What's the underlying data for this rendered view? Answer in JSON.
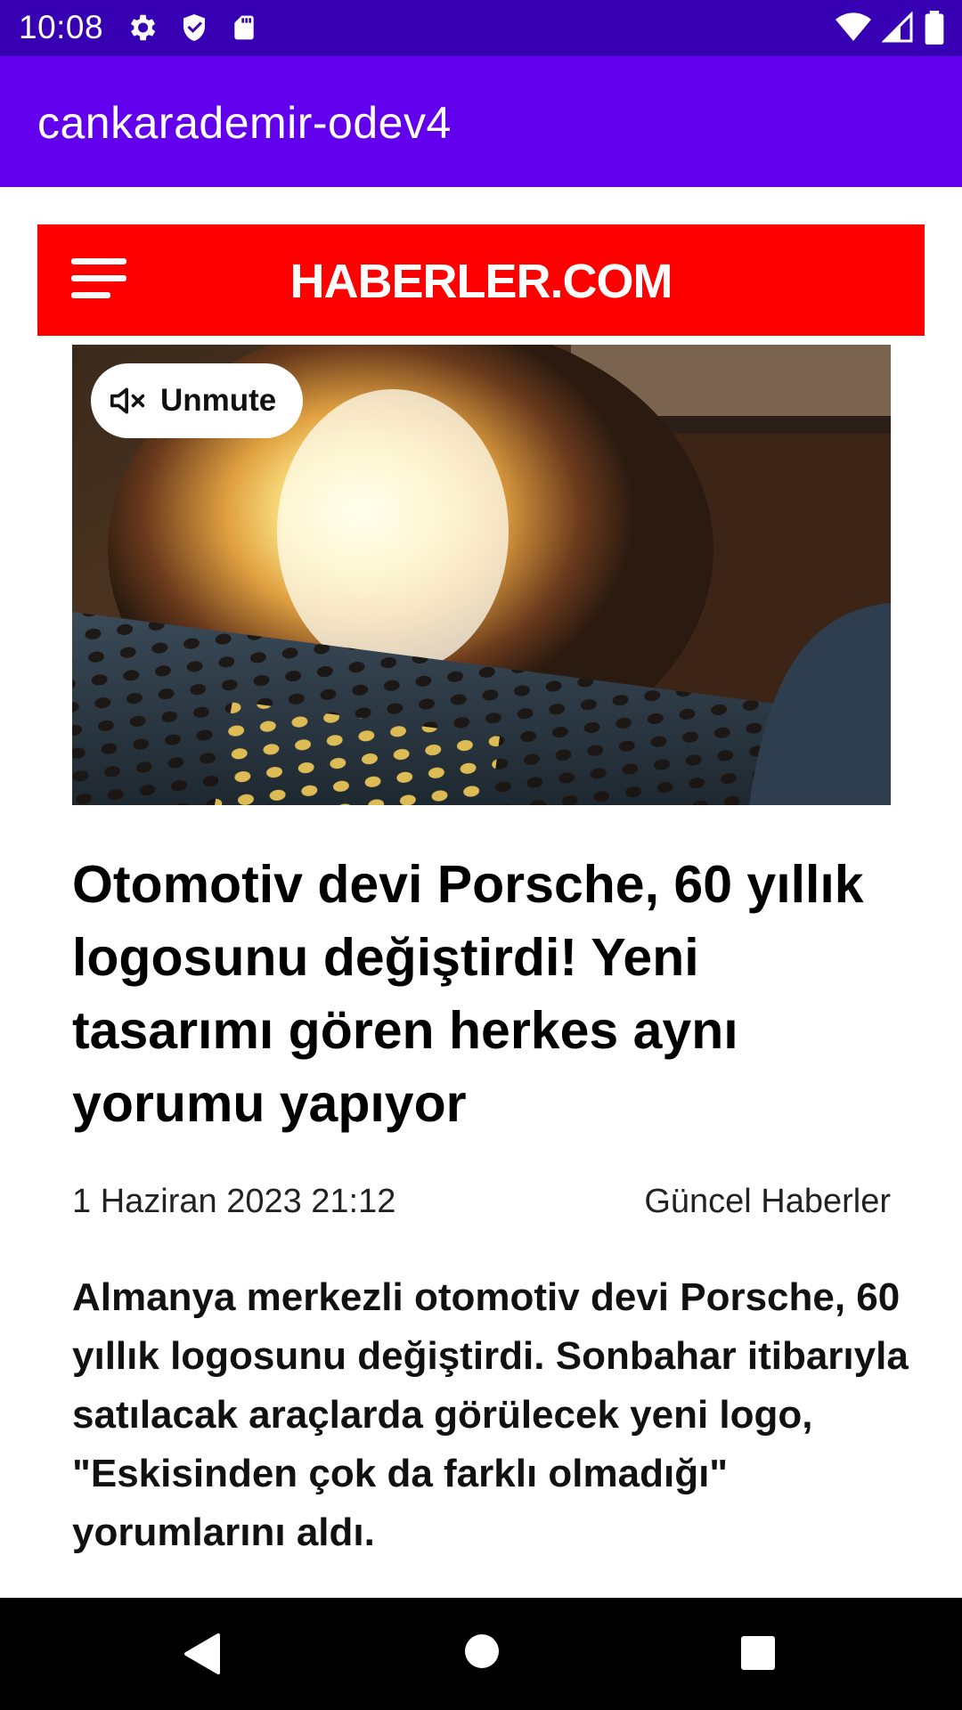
{
  "status_bar": {
    "time": "10:08",
    "left_icons": [
      "gear-icon",
      "shield-icon",
      "sd-card-icon"
    ],
    "right_icons": [
      "wifi-icon",
      "signal-icon",
      "battery-icon"
    ]
  },
  "app_bar": {
    "title": "cankarademir-odev4",
    "color": "#6200ee",
    "status_color": "#3700b3"
  },
  "site": {
    "logo_text": "HABERLER.COM",
    "header_color": "#ff0000",
    "menu_icon": "hamburger-menu-icon"
  },
  "video": {
    "unmute_label": "Unmute",
    "mute_icon": "speaker-muted-icon"
  },
  "article": {
    "headline": "Otomotiv devi Porsche, 60 yıllık logosunu değiştirdi! Yeni tasarımı gören herkes aynı yorumu yapıyor",
    "date": "1 Haziran 2023 21:12",
    "category": "Güncel Haberler",
    "summary": "Almanya merkezli otomotiv devi Porsche, 60 yıllık logosunu değiştirdi. Sonbahar itibarıyla satılacak araçlarda görülecek yeni logo, \"Eskisinden çok da farklı olmadığı\" yorumlarını aldı."
  },
  "nav_bar": {
    "icons": [
      "back-icon",
      "home-icon",
      "recents-icon"
    ]
  }
}
